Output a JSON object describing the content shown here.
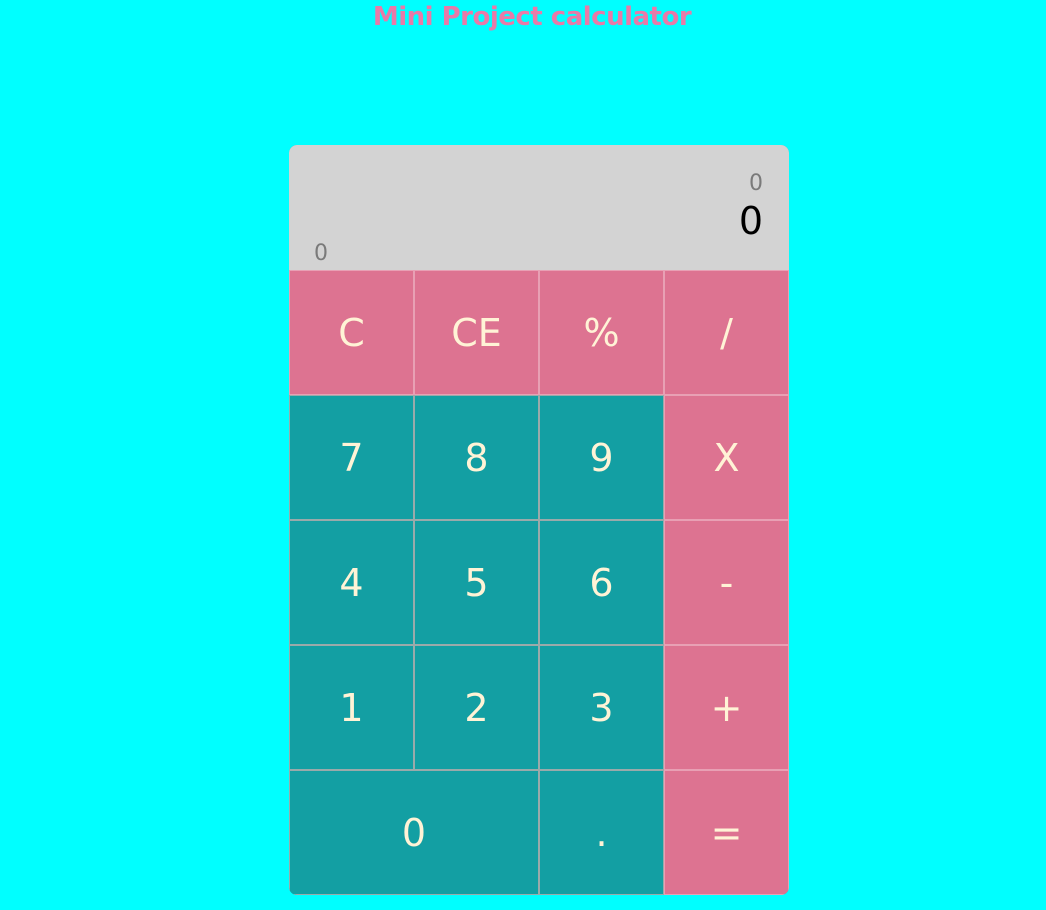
{
  "page": {
    "title": "Mini Project calculator"
  },
  "display": {
    "previous": "0",
    "current": "0",
    "memory": "0"
  },
  "keys": {
    "clear": "C",
    "clear_entry": "CE",
    "percent": "%",
    "divide": "/",
    "seven": "7",
    "eight": "8",
    "nine": "9",
    "multiply": "X",
    "four": "4",
    "five": "5",
    "six": "6",
    "subtract": "-",
    "one": "1",
    "two": "2",
    "three": "3",
    "add": "+",
    "zero": "0",
    "decimal": ".",
    "equals": "="
  },
  "colors": {
    "background": "#00ffff",
    "title": "#e87aa8",
    "display_bg": "#d3d3d3",
    "number_key": "#139fa3",
    "operator_key": "#dd7391",
    "key_text": "#fff3d6"
  }
}
